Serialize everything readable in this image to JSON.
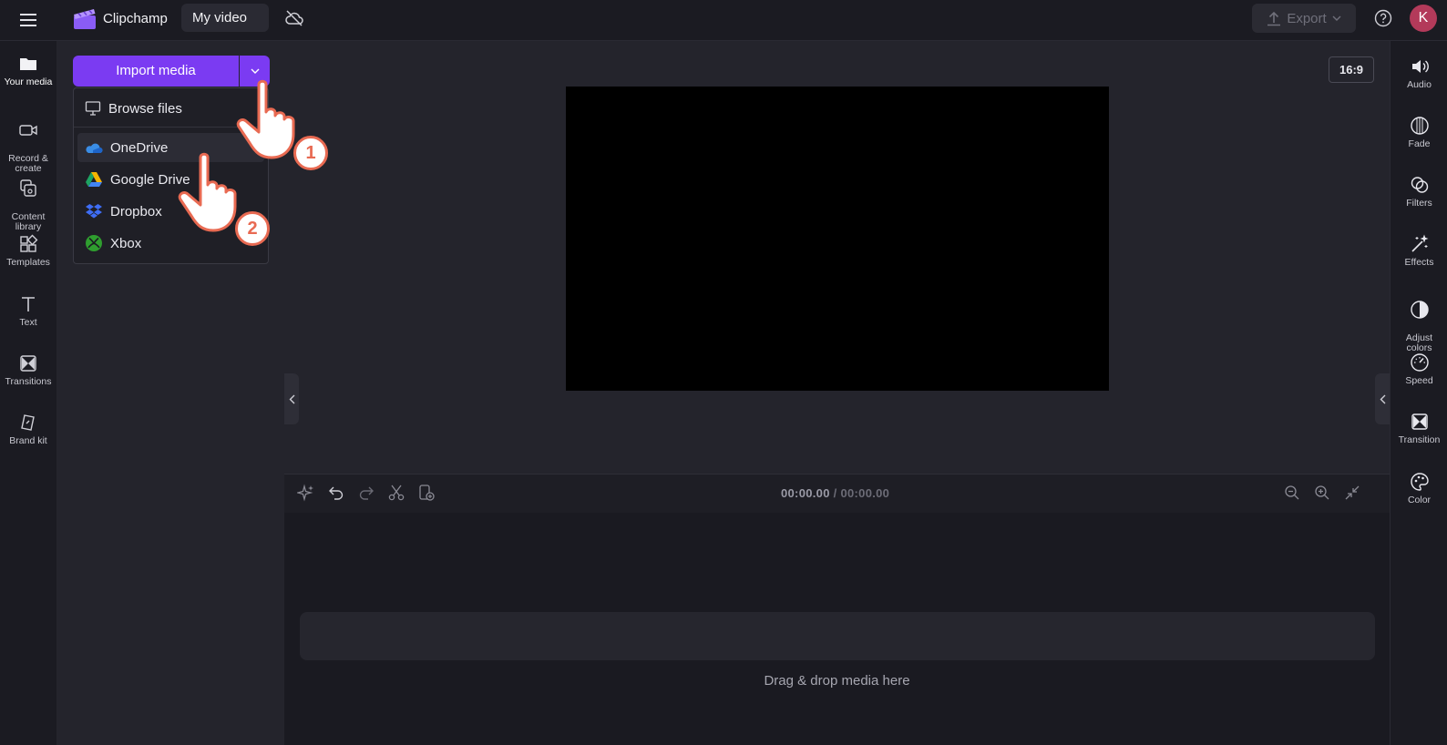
{
  "app": {
    "name": "Clipchamp",
    "project_title": "My video",
    "export_label": "Export",
    "user_initial": "K",
    "accent_color": "#7b3bf2"
  },
  "left_nav": [
    {
      "id": "your-media",
      "label": "Your media",
      "icon": "folder-icon"
    },
    {
      "id": "record-create",
      "label": "Record &\ncreate",
      "icon": "video-camera-icon"
    },
    {
      "id": "content-library",
      "label": "Content\nlibrary",
      "icon": "library-icon"
    },
    {
      "id": "templates",
      "label": "Templates",
      "icon": "templates-icon"
    },
    {
      "id": "text",
      "label": "Text",
      "icon": "text-icon"
    },
    {
      "id": "transitions",
      "label": "Transitions",
      "icon": "transitions-icon"
    },
    {
      "id": "brand-kit",
      "label": "Brand kit",
      "icon": "brand-kit-icon"
    }
  ],
  "media_panel": {
    "import_label": "Import media",
    "dropdown": [
      {
        "label": "Browse files",
        "icon": "monitor-icon"
      },
      {
        "label": "OneDrive",
        "icon": "onedrive-icon"
      },
      {
        "label": "Google Drive",
        "icon": "google-drive-icon"
      },
      {
        "label": "Dropbox",
        "icon": "dropbox-icon"
      },
      {
        "label": "Xbox",
        "icon": "xbox-icon"
      }
    ]
  },
  "preview": {
    "aspect_ratio": "16:9"
  },
  "timeline": {
    "current_time": "00:00.00",
    "separator": " / ",
    "duration": "00:00.00",
    "drop_hint": "Drag & drop media here"
  },
  "right_nav": [
    {
      "label": "Audio",
      "icon": "speaker-icon"
    },
    {
      "label": "Fade",
      "icon": "fade-icon"
    },
    {
      "label": "Filters",
      "icon": "filters-icon"
    },
    {
      "label": "Effects",
      "icon": "magic-wand-icon"
    },
    {
      "label": "Adjust\ncolors",
      "icon": "contrast-icon"
    },
    {
      "label": "Speed",
      "icon": "speedometer-icon"
    },
    {
      "label": "Transition",
      "icon": "transition-icon"
    },
    {
      "label": "Color",
      "icon": "palette-icon"
    }
  ],
  "annotations": {
    "step1": "1",
    "step2": "2"
  }
}
